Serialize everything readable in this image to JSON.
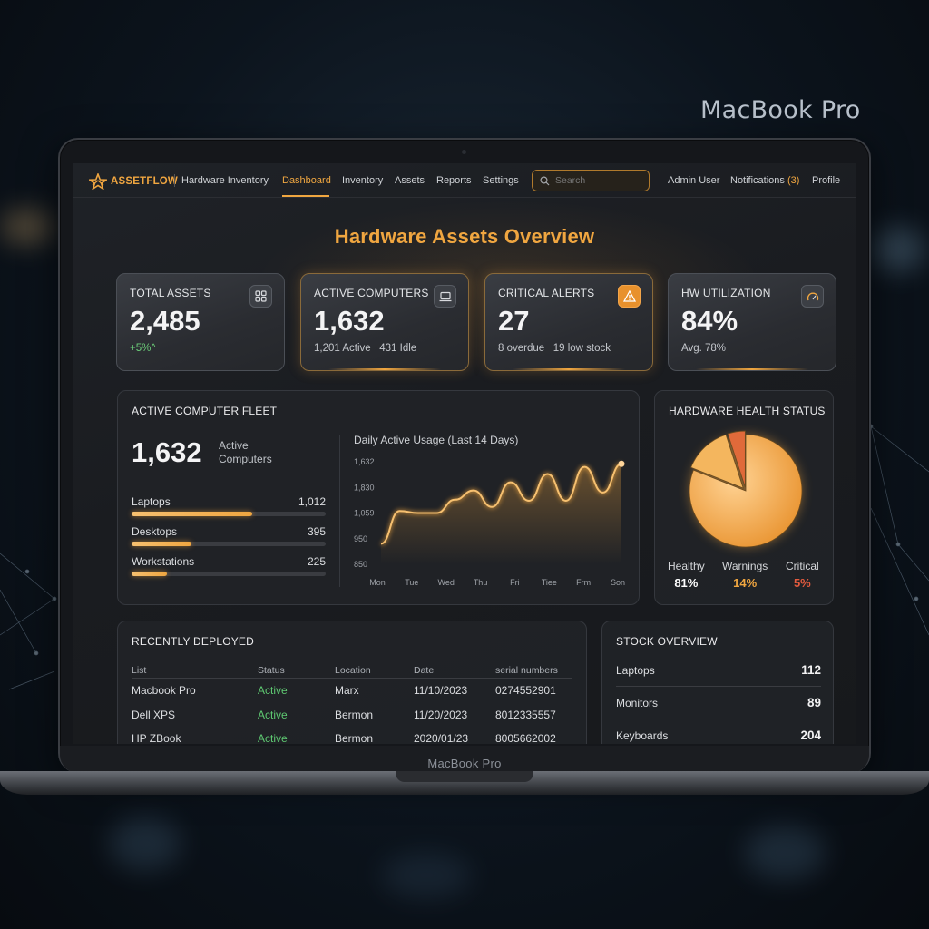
{
  "caption": "MacBook Pro",
  "device_label": "MacBook Pro",
  "nav": {
    "logo": "ASSETFLOW",
    "subtitle": "Hardware Inventory",
    "links": [
      "Dashboard",
      "Inventory",
      "Assets",
      "Reports",
      "Settings"
    ],
    "active_link": "Dashboard",
    "search_placeholder": "Search",
    "user": "Admin User",
    "notifications_label": "Notifications",
    "notifications_count": "(3)",
    "profile": "Profile"
  },
  "page_title": "Hardware Assets Overview",
  "stats": [
    {
      "label": "TOTAL ASSETS",
      "value": "2,485",
      "sub": "+5%^",
      "icon": "grid-icon"
    },
    {
      "label": "ACTIVE COMPUTERS",
      "value": "1,632",
      "sub": "1,201 Active   431 Idle",
      "icon": "laptop-icon"
    },
    {
      "label": "CRITICAL ALERTS",
      "value": "27",
      "sub": "8 overdue   19 low stock",
      "icon": "warning-icon"
    },
    {
      "label": "HW UTILIZATION",
      "value": "84%",
      "sub": "Avg. 78%",
      "icon": "gauge-icon"
    }
  ],
  "fleet": {
    "title": "ACTIVE COMPUTER FLEET",
    "total": "1,632",
    "total_label": "Active Computers",
    "rows": [
      {
        "label": "Laptops",
        "value": "1,012",
        "fraction": 0.62
      },
      {
        "label": "Desktops",
        "value": "395",
        "fraction": 0.31
      },
      {
        "label": "Workstations",
        "value": "225",
        "fraction": 0.18
      }
    ]
  },
  "chart_data": {
    "type": "line",
    "title": "Daily Active Usage (Last 14 Days)",
    "y_tick_labels": [
      "1,632",
      "1,830",
      "1,059",
      "950",
      "850"
    ],
    "x_tick_labels": [
      "Mon",
      "Tue",
      "Wed",
      "Thu",
      "Fri",
      "Tiee",
      "Frm",
      "Son"
    ],
    "series": [
      {
        "values": [
          0.2,
          0.52,
          0.5,
          0.5,
          0.63,
          0.72,
          0.56,
          0.8,
          0.62,
          0.88,
          0.62,
          0.95,
          0.7,
          0.98
        ]
      }
    ],
    "accent": "#f0a640"
  },
  "health": {
    "title": "HARDWARE HEALTH STATUS",
    "chart_data": {
      "type": "pie",
      "categories": [
        "Healthy",
        "Warnings",
        "Critical"
      ],
      "values": [
        81,
        14,
        5
      ],
      "colors": [
        "#f2ad4e",
        "#f4b65e",
        "#e06a3a"
      ]
    },
    "legend": [
      {
        "label": "Healthy",
        "pct": "81%",
        "color": "#ffffff"
      },
      {
        "label": "Warnings",
        "pct": "14%",
        "color": "#f0a640"
      },
      {
        "label": "Critical",
        "pct": "5%",
        "color": "#e45b3e"
      }
    ]
  },
  "recent": {
    "title": "RECENTLY DEPLOYED",
    "columns": [
      "List",
      "Status",
      "Location",
      "Date",
      "serial numbers"
    ],
    "rows": [
      [
        "Macbook Pro",
        "Active",
        "Marx",
        "11/10/2023",
        "0274552901"
      ],
      [
        "Dell XPS",
        "Active",
        "Bermon",
        "11/20/2023",
        "8012335557"
      ],
      [
        "HP ZBook",
        "Active",
        "Bermon",
        "2020/01/23",
        "8005662002"
      ]
    ]
  },
  "stock": {
    "title": "STOCK OVERVIEW",
    "rows": [
      {
        "label": "Laptops",
        "value": "112"
      },
      {
        "label": "Monitors",
        "value": "89"
      },
      {
        "label": "Keyboards",
        "value": "204"
      }
    ]
  }
}
